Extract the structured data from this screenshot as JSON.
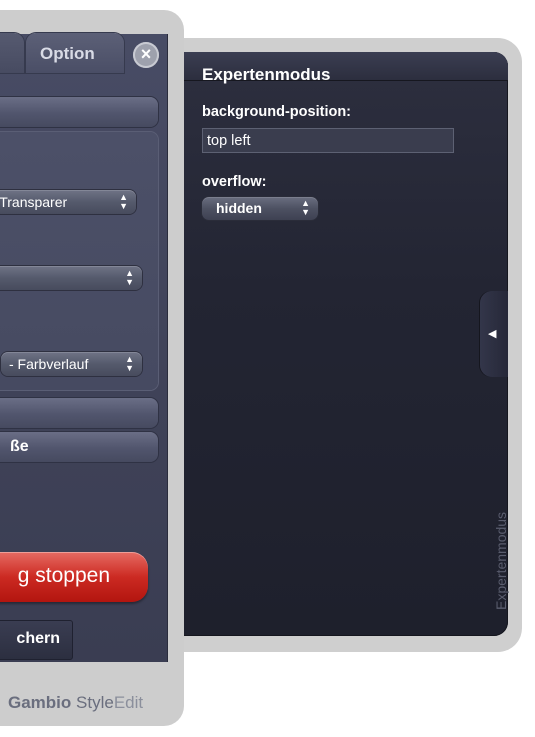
{
  "main_panel": {
    "tabs": {
      "option_label": "Option"
    },
    "close_symbol": "×",
    "sections": {
      "second_partial_label": "ße"
    },
    "selects": {
      "background_color": "ne Transparer",
      "middle": "",
      "gradient": "- Farbverlauf"
    },
    "stop_button_label": "g stoppen",
    "save_button_label": "chern",
    "footer": {
      "brand": "Gambio",
      "style": "Style",
      "edit": "Edit"
    }
  },
  "expert_panel": {
    "title": "Expertenmodus",
    "fields": {
      "bg_position_label": "background-position:",
      "bg_position_value": "top left",
      "overflow_label": "overflow:",
      "overflow_value": "hidden"
    },
    "collapse_icon": "◀",
    "vertical_label": "Expertenmodus"
  },
  "select_arrows": "▲\n▼"
}
